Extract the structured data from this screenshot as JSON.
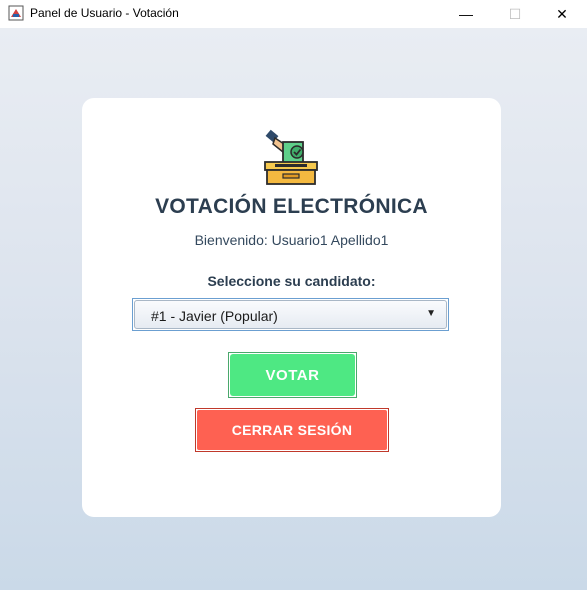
{
  "window": {
    "title": "Panel de Usuario - Votación",
    "minimize_glyph": "—",
    "maximize_glyph": "☐",
    "close_glyph": "✕"
  },
  "card": {
    "icon": "ballot-box-icon",
    "heading": "VOTACIÓN ELECTRÓNICA",
    "welcome": "Bienvenido: Usuario1 Apellido1",
    "select_label": "Seleccione su candidato:",
    "candidate_selected": "#1 - Javier (Popular)",
    "vote_button": "VOTAR",
    "logout_button": "CERRAR SESIÓN"
  },
  "colors": {
    "heading": "#2c3e50",
    "vote_button": "#4ee883",
    "logout_button": "#fe6152",
    "background_top": "#e9edf3",
    "background_bottom": "#cad9e8"
  }
}
